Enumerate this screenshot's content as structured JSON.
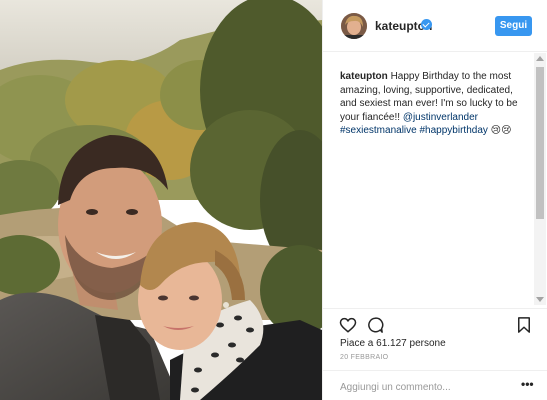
{
  "post": {
    "username": "kateupton",
    "follow_label": "Segui",
    "caption": {
      "username": "kateupton",
      "text_1": "Happy Birthday to the most amazing, loving, supportive, dedicated, and sexiest man ever! I'm so lucky to be your fiancée!! ",
      "mention": "@justinverlander",
      "hashtag_1": "#sexiestmanalive",
      "hashtag_2": "#happybirthday",
      "emoji": "😢😢"
    },
    "likes_label": "Piace a",
    "likes_count": "61.127",
    "likes_suffix": "persone",
    "date": "20 FEBBRAIO",
    "comment_placeholder": "Aggiungi un commento...",
    "more_label": "•••"
  },
  "icons": {
    "like": "heart-icon",
    "comment": "comment-bubble-icon",
    "save": "bookmark-icon",
    "verified": "verified-badge-icon",
    "more": "more-options-icon"
  },
  "colors": {
    "accent": "#3897f0",
    "link": "#003569",
    "text": "#262626",
    "muted": "#999999"
  }
}
